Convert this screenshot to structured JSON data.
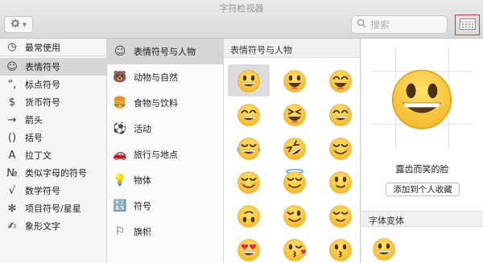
{
  "window": {
    "title": "字符检视器"
  },
  "toolbar": {
    "search_placeholder": "搜索"
  },
  "sidebar": {
    "items": [
      {
        "label": "最常使用",
        "icon": "clock-icon",
        "glyph": "◷"
      },
      {
        "label": "表情符号",
        "icon": "smiley-icon",
        "glyph": "☺"
      },
      {
        "label": "标点符号",
        "icon": "punctuation-icon",
        "glyph": "“,"
      },
      {
        "label": "货币符号",
        "icon": "dollar-icon",
        "glyph": "$"
      },
      {
        "label": "箭头",
        "icon": "arrow-icon",
        "glyph": "→"
      },
      {
        "label": "括号",
        "icon": "brackets-icon",
        "glyph": "()"
      },
      {
        "label": "拉丁文",
        "icon": "latin-icon",
        "glyph": "A"
      },
      {
        "label": "类似字母的符号",
        "icon": "numero-icon",
        "glyph": "№"
      },
      {
        "label": "数学符号",
        "icon": "sqrt-icon",
        "glyph": "√"
      },
      {
        "label": "项目符号/星星",
        "icon": "asterisk-icon",
        "glyph": "✻"
      },
      {
        "label": "象形文字",
        "icon": "pictograph-icon",
        "glyph": "✍"
      }
    ],
    "selected": 1
  },
  "categories": {
    "items": [
      {
        "label": "表情符号与人物",
        "icon": "smiley-icon",
        "glyph": "☺"
      },
      {
        "label": "动物与自然",
        "icon": "bear-icon",
        "glyph": "🐻"
      },
      {
        "label": "食物与饮料",
        "icon": "food-icon",
        "glyph": "🍔"
      },
      {
        "label": "活动",
        "icon": "ball-icon",
        "glyph": "⚽"
      },
      {
        "label": "旅行与地点",
        "icon": "car-icon",
        "glyph": "🚗"
      },
      {
        "label": "物体",
        "icon": "bulb-icon",
        "glyph": "💡"
      },
      {
        "label": "符号",
        "icon": "symbols-icon",
        "glyph": "🔣"
      },
      {
        "label": "旗帜",
        "icon": "flag-icon",
        "glyph": "⚐"
      }
    ],
    "selected": 0
  },
  "grid": {
    "header": "表情符号与人物",
    "emojis": [
      "grinning",
      "smiley",
      "smile",
      "grin",
      "laughing",
      "sweat_smile",
      "joy",
      "rofl",
      "relaxed",
      "blush",
      "innocent",
      "slight_smile",
      "upside_down",
      "wink",
      "relieved",
      "heart_eyes",
      "kissing_heart",
      "kissing"
    ],
    "selected": 0
  },
  "detail": {
    "name": "露齿而笑的脸",
    "add_favorite": "添加到个人收藏",
    "variants_header": "字体变体"
  }
}
